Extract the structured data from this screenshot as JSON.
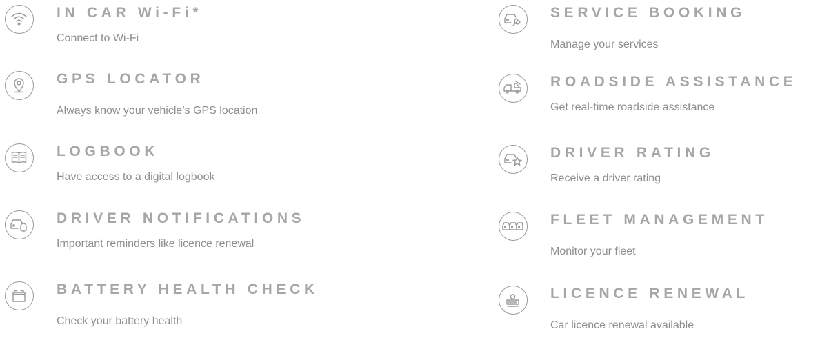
{
  "features_left": [
    {
      "title": "IN CAR Wi-Fi*",
      "description": "Connect to Wi-Fi",
      "icon": "wifi-icon"
    },
    {
      "title": "GPS LOCATOR",
      "description": "Always know your vehicle’s GPS location",
      "icon": "location-pin-icon"
    },
    {
      "title": "LOGBOOK",
      "description": "Have access to a digital logbook",
      "icon": "book-icon"
    },
    {
      "title": "DRIVER NOTIFICATIONS",
      "description": "Important reminders like licence renewal",
      "icon": "car-bell-icon"
    },
    {
      "title": "BATTERY HEALTH CHECK",
      "description": "Check your battery health",
      "icon": "battery-icon"
    }
  ],
  "features_right": [
    {
      "title": "SERVICE BOOKING",
      "description": "Manage your services",
      "icon": "car-wrench-icon"
    },
    {
      "title": "ROADSIDE ASSISTANCE",
      "description": "Get real-time roadside assistance",
      "icon": "tow-truck-icon"
    },
    {
      "title": "DRIVER RATING",
      "description": "Receive a driver rating",
      "icon": "car-star-icon"
    },
    {
      "title": "FLEET MANAGEMENT",
      "description": "Monitor your fleet",
      "icon": "car-fleet-icon"
    },
    {
      "title": "LICENCE RENEWAL",
      "description": "Car licence renewal available",
      "icon": "licence-disc-icon"
    }
  ],
  "colors": {
    "icon": "#9a9a9a",
    "title": "#a6a6a6",
    "description": "#8e8e8e"
  }
}
